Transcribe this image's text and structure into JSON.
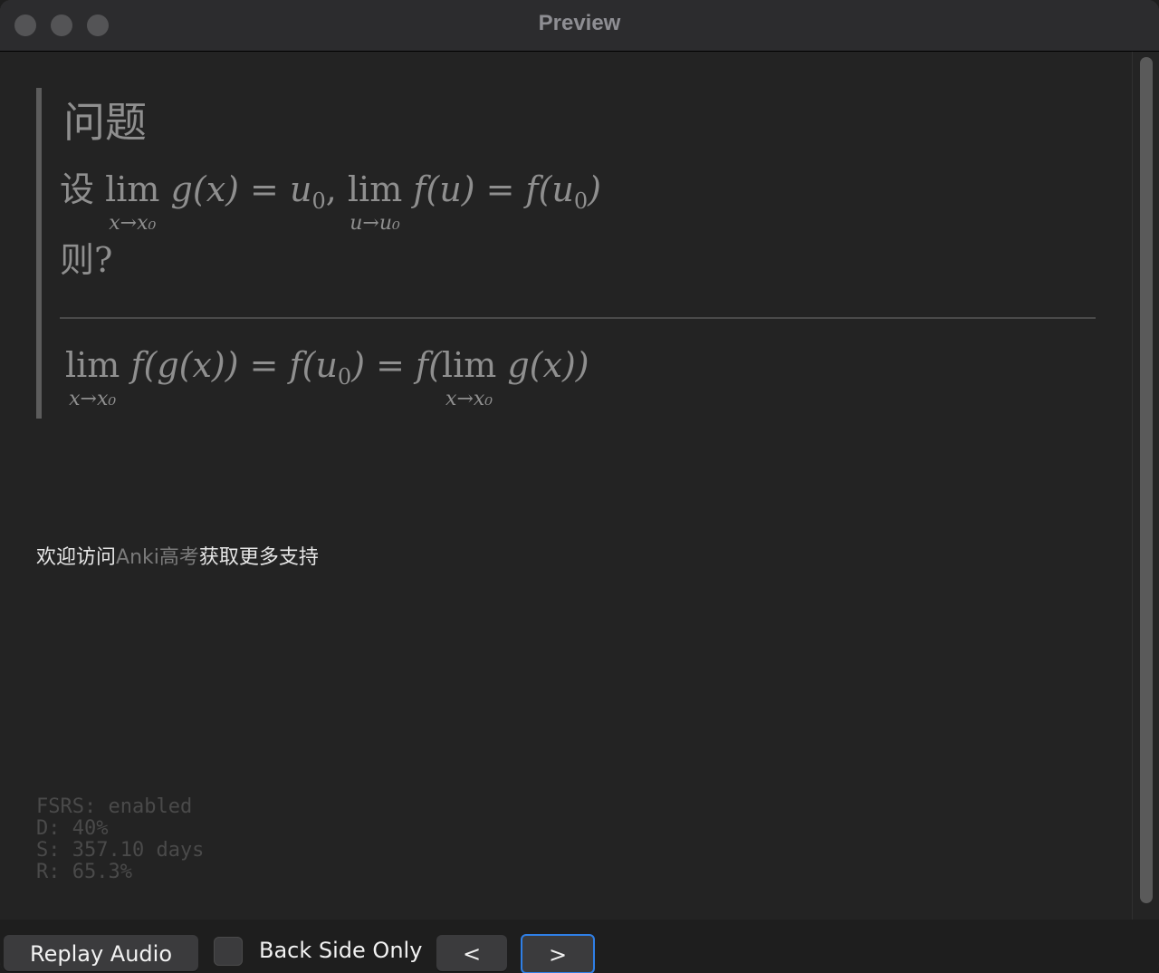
{
  "window": {
    "title": "Preview"
  },
  "card": {
    "question_title": "问题",
    "line1": {
      "prefix": "设",
      "lim1": "lim",
      "lim1_sub": "x→x₀",
      "expr1": "g(x) = u",
      "expr1_sub": "0",
      "sep": ", ",
      "lim2": "lim",
      "lim2_sub": "u→u₀",
      "expr2": "f(u) = f(u",
      "expr2_sub": "0",
      "expr2_end": ")"
    },
    "line2": "则?",
    "answer": {
      "lim1": "lim",
      "lim1_sub": "x→x₀",
      "expr1": "f(g(x)) = f(u",
      "expr1_sub": "0",
      "expr1_mid": ") = f(",
      "lim2": "lim",
      "lim2_sub": "x→x₀",
      "expr2": "g(x))"
    }
  },
  "promo": {
    "before": "欢迎访问",
    "link": "Anki高考",
    "after": "获取更多支持"
  },
  "fsrs": {
    "line1": "FSRS: enabled",
    "line2": "D: 40%",
    "line3": "S: 357.10 days",
    "line4": "R: 65.3%"
  },
  "bottombar": {
    "replay_label": "Replay Audio",
    "back_side_label": "Back Side Only",
    "prev_label": "<",
    "next_label": ">"
  }
}
